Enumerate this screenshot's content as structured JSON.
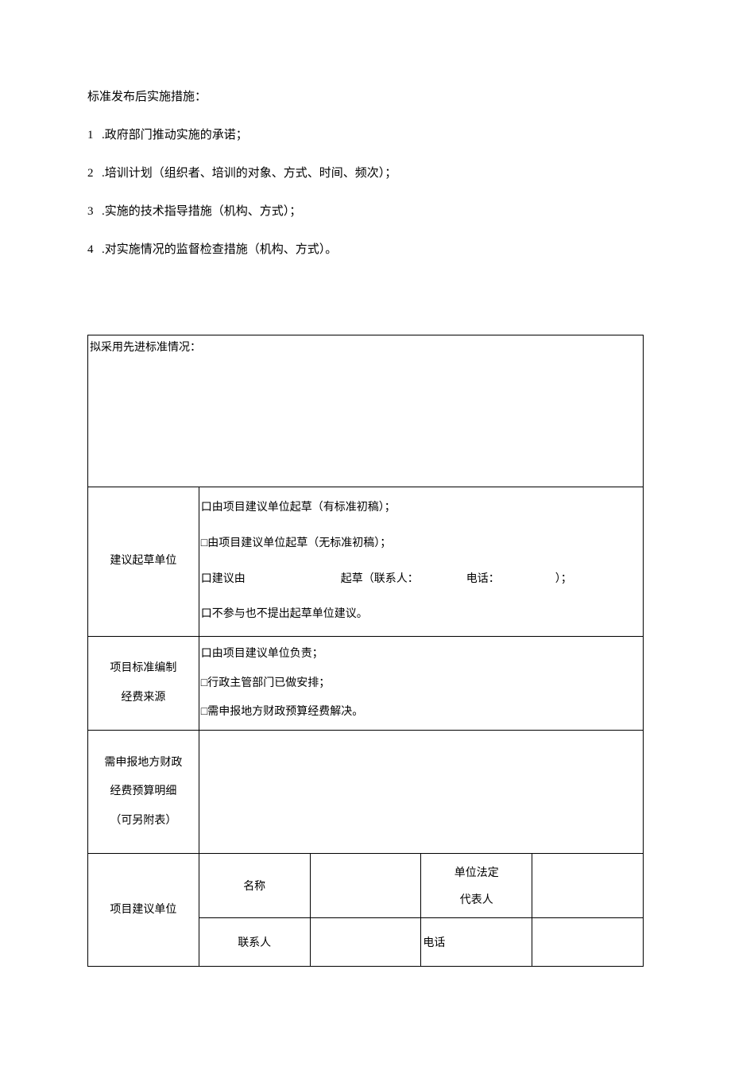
{
  "intro": {
    "title": "标准发布后实施措施：",
    "items": [
      ".政府部门推动实施的承诺；",
      ".培训计划（组织者、培训的对象、方式、时间、频次）；",
      ".实施的技术指导措施（机构、方式）；",
      ".对实施情况的监督检查措施（机构、方式）。"
    ]
  },
  "table": {
    "adopt_label": "拟采用先进标准情况：",
    "draft_unit": {
      "label": "建议起草单位",
      "opt1_pre": "口由项目建议单位起草（有标准初稿）；",
      "opt2_pre": "□由项目建议单位起草（无标准初稿）；",
      "opt3_pre": "口建议由",
      "opt3_mid": "起草（联系人：",
      "opt3_tel": "电话：",
      "opt3_end": "）；",
      "opt4": "口不参与也不提出起草单位建议。"
    },
    "funding": {
      "label_l1": "项目标准编制",
      "label_l2": "经费来源",
      "opt1": "口由项目建议单位负责；",
      "opt2": "□行政主管部门已做安排；",
      "opt3": "□需申报地方财政预算经费解决。"
    },
    "budget": {
      "l1": "需申报地方财政",
      "l2": "经费预算明细",
      "l3": "（可另附表）"
    },
    "proposer": {
      "label": "项目建议单位",
      "name_label": "名称",
      "legal_l1": "单位法定",
      "legal_l2": "代表人",
      "contact_label": "联系人",
      "tel_label": "电话"
    }
  }
}
